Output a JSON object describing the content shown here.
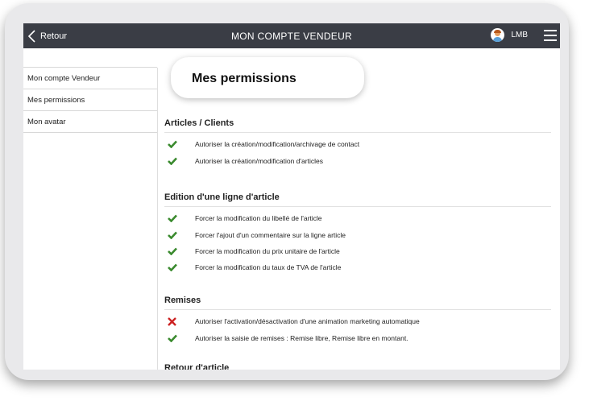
{
  "header": {
    "back_label": "Retour",
    "title": "MON COMPTE VENDEUR",
    "user_name": "LMB"
  },
  "sidebar": {
    "items": [
      {
        "label": "Mon compte Vendeur"
      },
      {
        "label": "Mes permissions"
      },
      {
        "label": "Mon avatar"
      }
    ]
  },
  "main": {
    "title": "Mes permissions",
    "sections": [
      {
        "title": "Articles / Clients",
        "items": [
          {
            "label": "Autoriser la création/modification/archivage de contact",
            "status": "allowed"
          },
          {
            "label": "Autoriser la création/modification d'articles",
            "status": "allowed"
          }
        ]
      },
      {
        "title": "Edition d'une ligne d'article",
        "items": [
          {
            "label": "Forcer la modification du libellé de l'article",
            "status": "allowed"
          },
          {
            "label": "Forcer l'ajout d'un commentaire sur la ligne article",
            "status": "allowed"
          },
          {
            "label": "Forcer la modification du prix unitaire de l'article",
            "status": "allowed"
          },
          {
            "label": "Forcer la modification du taux de TVA de l'article",
            "status": "allowed"
          }
        ]
      },
      {
        "title": "Remises",
        "items": [
          {
            "label": "Autoriser l'activation/désactivation d'une animation marketing automatique",
            "status": "denied"
          },
          {
            "label": "Autoriser la saisie de remises : Remise libre, Remise libre en montant.",
            "status": "allowed"
          }
        ]
      },
      {
        "title": "Retour d'article",
        "items": []
      }
    ]
  },
  "colors": {
    "topbar": "#3a3d45",
    "allowed": "#3a8a2e",
    "denied": "#cc2222"
  },
  "icons": {
    "allowed": "check-icon",
    "denied": "cross-icon"
  }
}
